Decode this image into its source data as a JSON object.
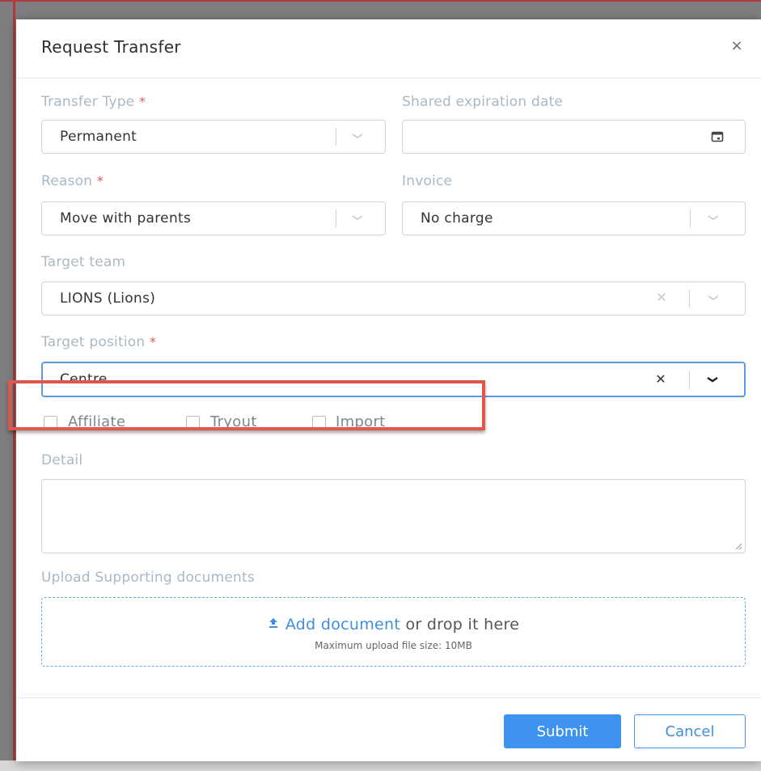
{
  "modal": {
    "title": "Request Transfer",
    "close_glyph": "×"
  },
  "form": {
    "transfer_type": {
      "label": "Transfer Type",
      "required_mark": "*",
      "value": "Permanent"
    },
    "shared_expiration_date": {
      "label": "Shared expiration date",
      "value": ""
    },
    "reason": {
      "label": "Reason",
      "required_mark": "*",
      "value": "Move with parents"
    },
    "invoice": {
      "label": "Invoice",
      "value": "No charge"
    },
    "target_team": {
      "label": "Target team",
      "value": "LIONS (Lions)"
    },
    "target_position": {
      "label": "Target position",
      "required_mark": "*",
      "value": "Centre"
    },
    "checkboxes": [
      {
        "label": "Affiliate",
        "checked": false
      },
      {
        "label": "Tryout",
        "checked": false
      },
      {
        "label": "Import",
        "checked": false
      }
    ],
    "detail": {
      "label": "Detail",
      "value": ""
    },
    "upload": {
      "label": "Upload Supporting documents",
      "link_text": "Add document",
      "rest_text": " or drop it here",
      "hint": "Maximum upload file size: 10MB"
    }
  },
  "footer": {
    "submit_label": "Submit",
    "cancel_label": "Cancel"
  },
  "colors": {
    "accent": "#3e93ee",
    "label": "#a9b8c4",
    "required": "#e05a5a",
    "highlight": "#e0564b"
  },
  "icons": [
    "close-icon",
    "chevron-down-icon",
    "calendar-icon",
    "clear-icon",
    "upload-icon",
    "resize-grip-icon"
  ]
}
